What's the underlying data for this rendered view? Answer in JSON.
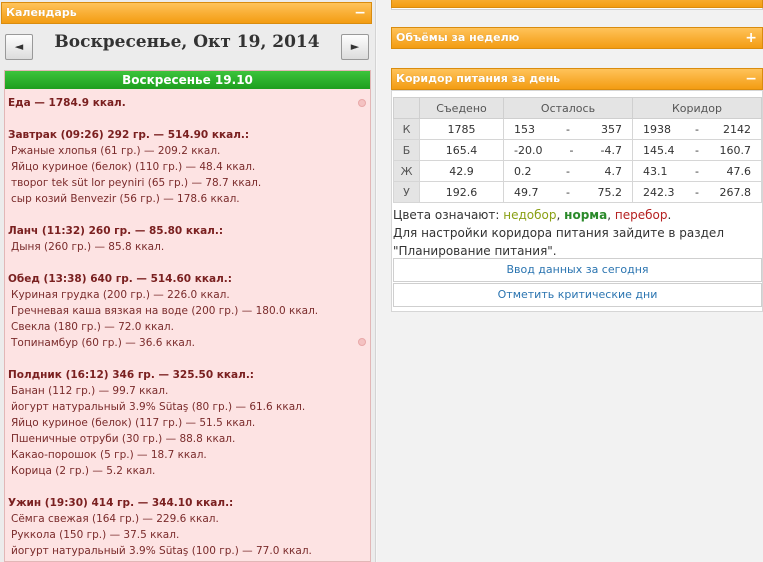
{
  "calendar": {
    "panel_title": "Календарь",
    "collapse_glyph": "−",
    "prev_glyph": "◄",
    "next_glyph": "►",
    "date_title": "Воскресенье, Окт 19, 2014",
    "day_header": "Воскресенье 19.10"
  },
  "diary": {
    "total": "Еда — 1784.9 ккал.",
    "meals": [
      {
        "head": "Завтрак (09:26) 292 гр. — 514.90 ккал.:",
        "items": [
          "Ржаные хлопья (61 гр.) — 209.2 ккал.",
          "Яйцо куриное (белок) (110 гр.) — 48.4 ккал.",
          "творог tek süt lor peyniri (65 гр.) — 78.7 ккал.",
          "сыр козий Benvezir (56 гр.) — 178.6 ккал."
        ]
      },
      {
        "head": "Ланч (11:32) 260 гр. — 85.80 ккал.:",
        "items": [
          "Дыня (260 гр.) — 85.8 ккал."
        ]
      },
      {
        "head": "Обед (13:38) 640 гр. — 514.60 ккал.:",
        "items": [
          "Куриная грудка (200 гр.) — 226.0 ккал.",
          "Гречневая каша вязкая на воде (200 гр.) — 180.0 ккал.",
          "Свекла (180 гр.) — 72.0 ккал.",
          "Топинамбур (60 гр.) — 36.6 ккал."
        ]
      },
      {
        "head": "Полдник (16:12) 346 гр. — 325.50 ккал.:",
        "items": [
          "Банан (112 гр.) — 99.7 ккал.",
          "йогурт натуральный 3.9% Sütaş (80 гр.) — 61.6 ккал.",
          "Яйцо куриное (белок) (117 гр.) — 51.5 ккал.",
          "Пшеничные отруби (30 гр.) — 88.8 ккал.",
          "Какао-порошок (5 гр.) — 18.7 ккал.",
          "Корица (2 гр.) — 5.2 ккал."
        ]
      },
      {
        "head": "Ужин (19:30) 414 гр. — 344.10 ккал.:",
        "items": [
          "Сёмга свежая (164 гр.) — 229.6 ккал.",
          "Руккола (150 гр.) — 37.5 ккал.",
          "йогурт натуральный 3.9% Sütaş (100 гр.) — 77.0 ккал."
        ]
      }
    ]
  },
  "weekly": {
    "title": "Объёмы за неделю",
    "expand_glyph": "+"
  },
  "corridor": {
    "title": "Коридор питания за день",
    "collapse_glyph": "−",
    "headers": [
      "",
      "Съедено",
      "Осталось",
      "Коридор"
    ],
    "dash": "-",
    "rows": [
      {
        "label": "К",
        "eaten": "1785",
        "eaten_color": "green",
        "left_min": "153",
        "left_max": "357",
        "corr_min": "1938",
        "corr_max": "2142"
      },
      {
        "label": "Б",
        "eaten": "165.4",
        "eaten_color": "red",
        "left_min": "-20.0",
        "left_max": "-4.7",
        "corr_min": "145.4",
        "corr_max": "160.7"
      },
      {
        "label": "Ж",
        "eaten": "42.9",
        "eaten_color": "green",
        "left_min": "0.2",
        "left_max": "4.7",
        "corr_min": "43.1",
        "corr_max": "47.6"
      },
      {
        "label": "У",
        "eaten": "192.6",
        "eaten_color": "green",
        "left_min": "49.7",
        "left_max": "75.2",
        "corr_min": "242.3",
        "corr_max": "267.8"
      }
    ],
    "legend_prefix": "Цвета означают:",
    "legend_under": "недобор",
    "legend_sep1": ",",
    "legend_norm": "норма",
    "legend_sep2": ",",
    "legend_over": "перебор",
    "legend_end": ".",
    "hint": "Для настройки коридора питания зайдите в раздел \"Планирование питания\".",
    "btn_today": "Ввод данных за сегодня",
    "btn_critical": "Отметить критические дни"
  }
}
